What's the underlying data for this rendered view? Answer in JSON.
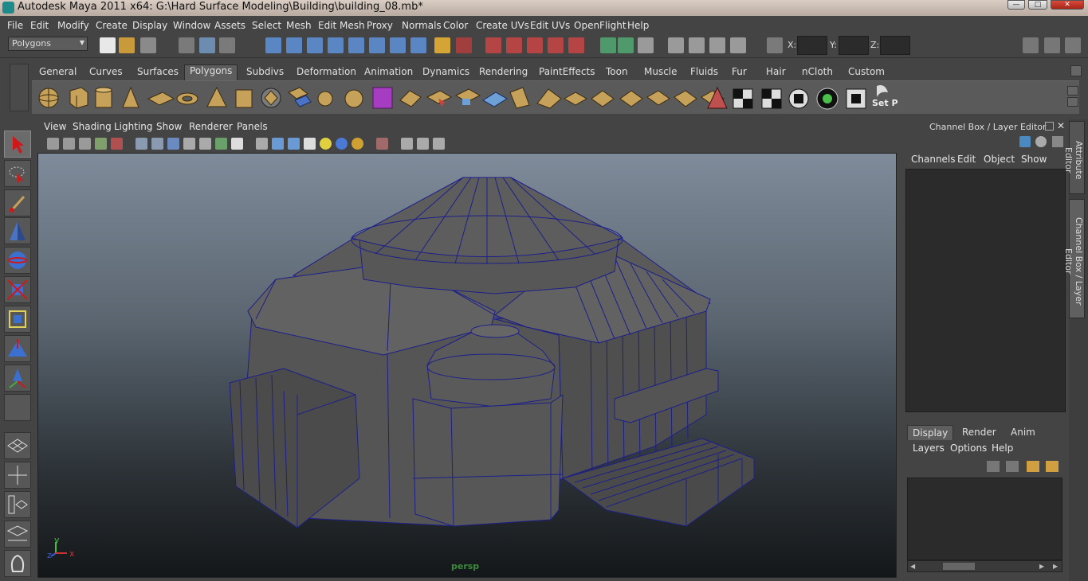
{
  "window": {
    "title": "Autodesk Maya 2011 x64: G:\\Hard Surface Modeling\\Building\\building_08.mb*",
    "min_label": "—",
    "max_label": "□",
    "close_label": "✕"
  },
  "menubar": {
    "items": [
      "File",
      "Edit",
      "Modify",
      "Create",
      "Display",
      "Window",
      "Assets",
      "Select",
      "Mesh",
      "Edit Mesh",
      "Proxy",
      "Normals",
      "Color",
      "Create UVs",
      "Edit UVs",
      "OpenFlight",
      "Help"
    ]
  },
  "statusline": {
    "menuset": "Polygons",
    "x_label": "X:",
    "y_label": "Y:",
    "z_label": "Z:"
  },
  "shelf": {
    "tabs": [
      "General",
      "Curves",
      "Surfaces",
      "Polygons",
      "Subdivs",
      "Deformation",
      "Animation",
      "Dynamics",
      "Rendering",
      "PaintEffects",
      "Toon",
      "Muscle",
      "Fluids",
      "Fur",
      "Hair",
      "nCloth",
      "Custom"
    ],
    "active_tab": "Polygons",
    "last_button_label": "Set P"
  },
  "viewport": {
    "menu": [
      "View",
      "Shading",
      "Lighting",
      "Show",
      "Renderer",
      "Panels"
    ],
    "camera_label": "persp",
    "axis_y": "y",
    "axis_z": "z",
    "axis_x": "x"
  },
  "channelbox": {
    "title": "Channel Box / Layer Editor",
    "menu": [
      "Channels",
      "Edit",
      "Object",
      "Show"
    ]
  },
  "layereditor": {
    "tabs": [
      "Display",
      "Render",
      "Anim"
    ],
    "active_tab": "Display",
    "menu": [
      "Layers",
      "Options",
      "Help"
    ]
  },
  "sidetabs": [
    "Attribute Editor",
    "Channel Box / Layer Editor"
  ],
  "colors": {
    "mesh_face": "#5a5a5a",
    "wireframe": "#1c1f8a",
    "viewport_top": "#7f8b9a",
    "viewport_bottom": "#141719"
  }
}
